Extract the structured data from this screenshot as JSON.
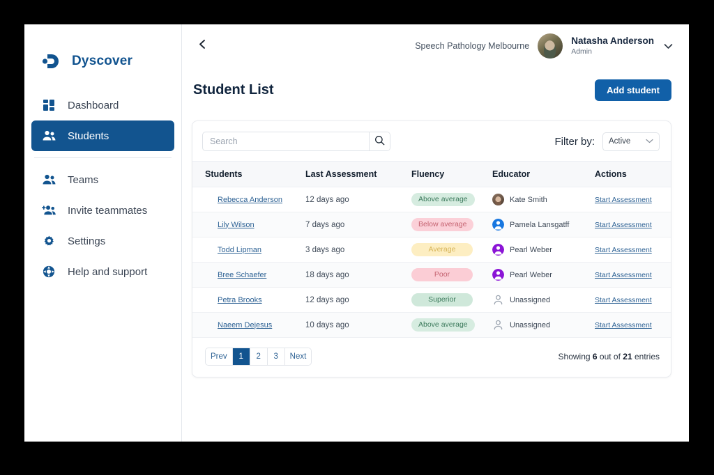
{
  "brand": {
    "name": "Dyscover"
  },
  "sidebar": {
    "items": [
      {
        "label": "Dashboard",
        "icon": "dashboard-icon",
        "active": false
      },
      {
        "label": "Students",
        "icon": "people-icon",
        "active": true
      },
      {
        "label": "Teams",
        "icon": "team-icon",
        "active": false
      },
      {
        "label": "Invite teammates",
        "icon": "person-add-icon",
        "active": false
      },
      {
        "label": "Settings",
        "icon": "gear-icon",
        "active": false
      },
      {
        "label": "Help and support",
        "icon": "help-icon",
        "active": false
      }
    ]
  },
  "topbar": {
    "back_icon": "chevron-left-icon",
    "org": "Speech Pathology Melbourne",
    "user_name": "Natasha Anderson",
    "user_role": "Admin",
    "chevron_icon": "chevron-down-icon"
  },
  "page": {
    "title": "Student List",
    "add_button": "Add student"
  },
  "toolbar": {
    "search_placeholder": "Search",
    "search_value": "",
    "search_icon": "search-icon",
    "filter_label": "Filter by:",
    "filter_value": "Active",
    "filter_options": [
      "Active"
    ]
  },
  "table": {
    "columns": [
      "Students",
      "Last Assessment",
      "Fluency",
      "Educator",
      "Actions"
    ],
    "action_label": "Start Assessment",
    "rows": [
      {
        "student": "Rebecca Anderson",
        "last_assessment": "12 days ago",
        "fluency": "Above average",
        "fluency_bg": "#d6ece0",
        "fluency_fg": "#3c7a5c",
        "educator": "Kate Smith",
        "avatar_type": "photo",
        "avatar_color": "#7a5c48"
      },
      {
        "student": "Lily Wilson",
        "last_assessment": "7 days ago",
        "fluency": "Below average",
        "fluency_bg": "#fbd0d8",
        "fluency_fg": "#c4616f",
        "educator": "Pamela Lansgatff",
        "avatar_type": "initial",
        "avatar_color": "#1877e0"
      },
      {
        "student": "Todd Lipman",
        "last_assessment": "3 days ago",
        "fluency": "Average",
        "fluency_bg": "#fdeec2",
        "fluency_fg": "#d6b458",
        "educator": "Pearl Weber",
        "avatar_type": "initial",
        "avatar_color": "#8b14d6"
      },
      {
        "student": "Bree Schaefer",
        "last_assessment": "18 days ago",
        "fluency": "Poor",
        "fluency_bg": "#fbcdd5",
        "fluency_fg": "#c4616f",
        "educator": "Pearl Weber",
        "avatar_type": "initial",
        "avatar_color": "#8b14d6"
      },
      {
        "student": "Petra Brooks",
        "last_assessment": "12 days ago",
        "fluency": "Superior",
        "fluency_bg": "#cfe8da",
        "fluency_fg": "#3c7a5c",
        "educator": "Unassigned",
        "avatar_type": "outline",
        "avatar_color": "#9aa3af"
      },
      {
        "student": "Naeem Dejesus",
        "last_assessment": "10 days ago",
        "fluency": "Above average",
        "fluency_bg": "#d6ece0",
        "fluency_fg": "#3c7a5c",
        "educator": "Unassigned",
        "avatar_type": "outline",
        "avatar_color": "#9aa3af"
      }
    ]
  },
  "pagination": {
    "prev": "Prev",
    "pages": [
      "1",
      "2",
      "3"
    ],
    "current": "1",
    "next": "Next",
    "showing_prefix": "Showing ",
    "showing_count": "6",
    "showing_mid": " out of ",
    "showing_total": "21",
    "showing_suffix": " entries"
  },
  "colors": {
    "brand_blue": "#11538f",
    "accent_blue": "#1160a8",
    "link_blue": "#2f6395"
  }
}
